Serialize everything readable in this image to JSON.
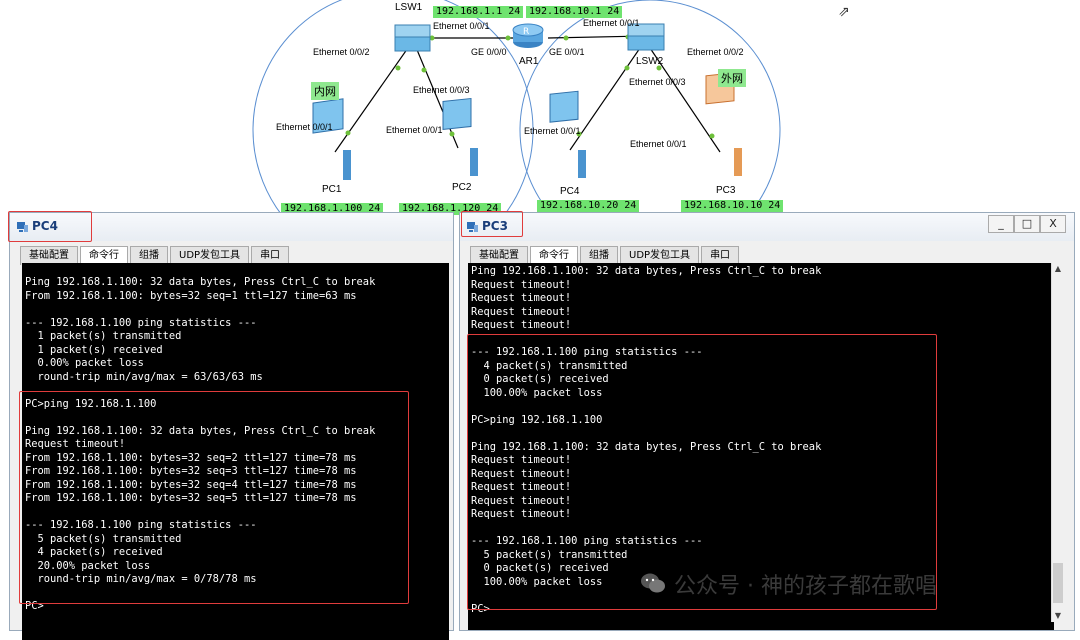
{
  "topology": {
    "zones": {
      "inner": "内网",
      "outer": "外网"
    },
    "devices": {
      "lsw1": "LSW1",
      "ar1": "AR1",
      "lsw2": "LSW2",
      "pc1": "PC1",
      "pc2": "PC2",
      "pc4": "PC4",
      "pc3": "PC3"
    },
    "ports": {
      "lsw1_e001": "Ethernet 0/0/1",
      "lsw1_e002": "Ethernet 0/0/2",
      "lsw1_e003": "Ethernet 0/0/3",
      "pc1_e001": "Ethernet 0/0/1",
      "pc2_e001": "Ethernet 0/0/1",
      "ar1_ge000": "GE 0/0/0",
      "ar1_ge001": "GE 0/0/1",
      "lsw2_e001": "Ethernet 0/0/1",
      "lsw2_e002": "Ethernet 0/0/2",
      "lsw2_e003": "Ethernet 0/0/3",
      "pc4_e001": "Ethernet 0/0/1",
      "pc3_e001": "Ethernet 0/0/1"
    },
    "ips": {
      "ar1_left": "192.168.1.1 24",
      "ar1_right": "192.168.10.1 24",
      "pc1": "192.168.1.100 24",
      "pc2": "192.168.1.120 24",
      "pc4": "192.168.10.20 24",
      "pc3": "192.168.10.10 24"
    }
  },
  "tab_labels": [
    "基础配置",
    "命令行",
    "组播",
    "UDP发包工具",
    "串口"
  ],
  "active_tab": "命令行",
  "window_left": {
    "title": "PC4",
    "lines": [
      "Ping 192.168.1.100: 32 data bytes, Press Ctrl_C to break",
      "From 192.168.1.100: bytes=32 seq=1 ttl=127 time=63 ms",
      "",
      "--- 192.168.1.100 ping statistics ---",
      "  1 packet(s) transmitted",
      "  1 packet(s) received",
      "  0.00% packet loss",
      "  round-trip min/avg/max = 63/63/63 ms",
      "",
      "PC>ping 192.168.1.100",
      "",
      "Ping 192.168.1.100: 32 data bytes, Press Ctrl_C to break",
      "Request timeout!",
      "From 192.168.1.100: bytes=32 seq=2 ttl=127 time=78 ms",
      "From 192.168.1.100: bytes=32 seq=3 ttl=127 time=78 ms",
      "From 192.168.1.100: bytes=32 seq=4 ttl=127 time=78 ms",
      "From 192.168.1.100: bytes=32 seq=5 ttl=127 time=78 ms",
      "",
      "--- 192.168.1.100 ping statistics ---",
      "  5 packet(s) transmitted",
      "  4 packet(s) received",
      "  20.00% packet loss",
      "  round-trip min/avg/max = 0/78/78 ms",
      "",
      "PC>"
    ]
  },
  "window_right": {
    "title": "PC3",
    "buttons": {
      "minimize": "_",
      "maximize": "□",
      "close": "X"
    },
    "lines": [
      "Ping 192.168.1.100: 32 data bytes, Press Ctrl_C to break",
      "Request timeout!",
      "Request timeout!",
      "Request timeout!",
      "Request timeout!",
      "",
      "--- 192.168.1.100 ping statistics ---",
      "  4 packet(s) transmitted",
      "  0 packet(s) received",
      "  100.00% packet loss",
      "",
      "PC>ping 192.168.1.100",
      "",
      "Ping 192.168.1.100: 32 data bytes, Press Ctrl_C to break",
      "Request timeout!",
      "Request timeout!",
      "Request timeout!",
      "Request timeout!",
      "Request timeout!",
      "",
      "--- 192.168.1.100 ping statistics ---",
      "  5 packet(s) transmitted",
      "  0 packet(s) received",
      "  100.00% packet loss",
      "",
      "PC>"
    ]
  },
  "watermark": "公众号 · 神的孩子都在歌唱"
}
